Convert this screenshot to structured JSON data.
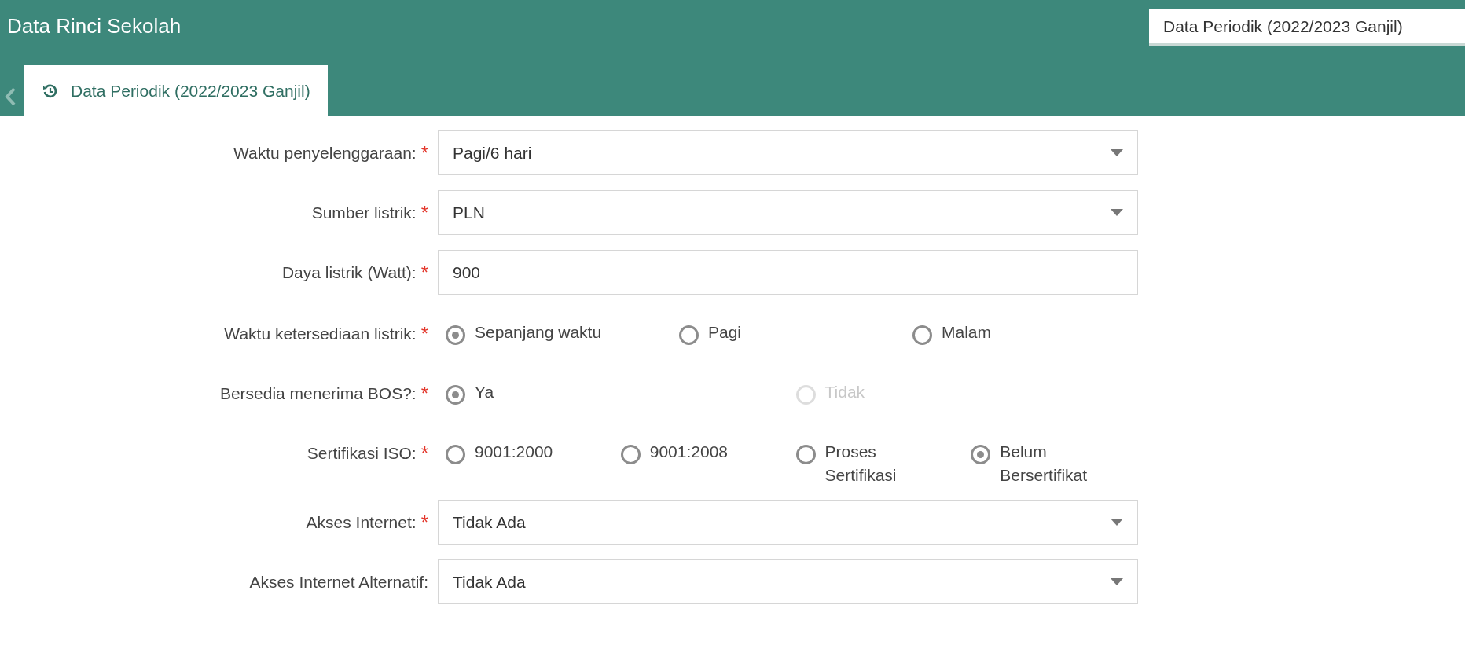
{
  "header": {
    "title": "Data Rinci Sekolah",
    "period_box": "Data Periodik (2022/2023 Ganjil)"
  },
  "tabs": [
    {
      "label": "Data Periodik (2022/2023 Ganjil)",
      "selected": true
    }
  ],
  "form": [
    {
      "kind": "select",
      "label": "Waktu penyelenggaraan:",
      "required_mark": "*",
      "value": "Pagi/6 hari"
    },
    {
      "kind": "select",
      "label": "Sumber listrik:",
      "required_mark": "*",
      "value": "PLN"
    },
    {
      "kind": "text",
      "label": "Daya listrik (Watt):",
      "required_mark": "*",
      "value": "900"
    },
    {
      "kind": "radio",
      "label": "Waktu ketersediaan listrik:",
      "required_mark": "*",
      "options": [
        {
          "label": "Sepanjang waktu",
          "selected": true,
          "disabled": false
        },
        {
          "label": "Pagi",
          "selected": false,
          "disabled": false
        },
        {
          "label": "Malam",
          "selected": false,
          "disabled": false
        }
      ]
    },
    {
      "kind": "radio",
      "label": "Bersedia menerima BOS?:",
      "required_mark": "*",
      "options": [
        {
          "label": "Ya",
          "selected": true,
          "disabled": false
        },
        {
          "label": "Tidak",
          "selected": false,
          "disabled": true
        }
      ]
    },
    {
      "kind": "radio",
      "label": "Sertifikasi ISO:",
      "required_mark": "*",
      "options": [
        {
          "label": "9001:2000",
          "selected": false,
          "disabled": false
        },
        {
          "label": "9001:2008",
          "selected": false,
          "disabled": false
        },
        {
          "label": "Proses Sertifikasi",
          "selected": false,
          "disabled": false
        },
        {
          "label": "Belum Bersertifikat",
          "selected": true,
          "disabled": false
        }
      ]
    },
    {
      "kind": "select",
      "label": "Akses Internet:",
      "required_mark": "*",
      "value": "Tidak Ada"
    },
    {
      "kind": "select",
      "label": "Akses Internet Alternatif:",
      "value": "Tidak Ada"
    }
  ]
}
